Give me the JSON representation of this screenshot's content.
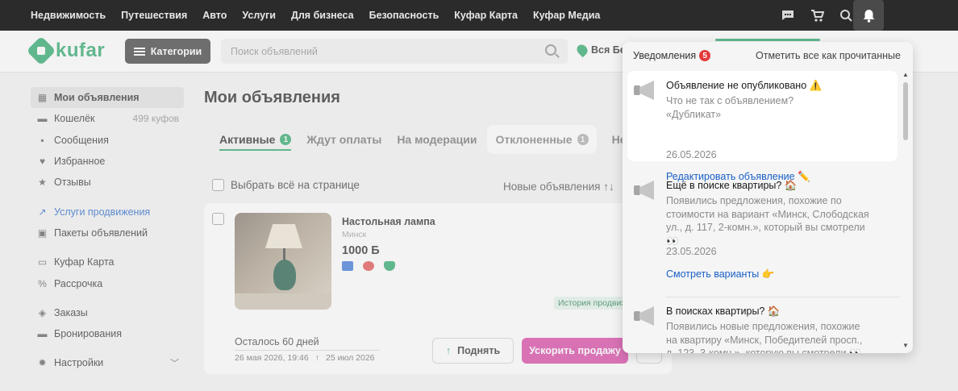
{
  "topnav": [
    "Недвижимость",
    "Путешествия",
    "Авто",
    "Услуги",
    "Для бизнеса",
    "Безопасность",
    "Куфар Карта",
    "Куфар Медиа"
  ],
  "top_icons": [
    "chat-icon",
    "cart-icon",
    "search-saved-icon",
    "heart-icon",
    "bell-icon"
  ],
  "header": {
    "logo": "kufar",
    "categories_label": "Категории",
    "search_placeholder": "Поиск объявлений",
    "region": "Вся Бе"
  },
  "sidebar": {
    "items": [
      {
        "label": "Мои объявления",
        "icon": "grid-icon",
        "active": true
      },
      {
        "label": "Кошелёк",
        "icon": "wallet-icon",
        "extra": "499 куфов"
      },
      {
        "label": "Сообщения",
        "icon": "chat-icon"
      },
      {
        "label": "Избранное",
        "icon": "heart-icon"
      },
      {
        "label": "Отзывы",
        "icon": "star-icon"
      },
      {
        "label": "Услуги продвижения",
        "icon": "trend-icon",
        "link": true
      },
      {
        "label": "Пакеты объявлений",
        "icon": "package-icon"
      },
      {
        "label": "Куфар Карта",
        "icon": "card-icon"
      },
      {
        "label": "Рассрочка",
        "icon": "percent-icon"
      },
      {
        "label": "Заказы",
        "icon": "box-icon"
      },
      {
        "label": "Бронирования",
        "icon": "bed-icon"
      },
      {
        "label": "Настройки",
        "icon": "gear-icon"
      }
    ]
  },
  "main": {
    "title": "Мои объявления",
    "tabs": [
      {
        "label": "Активные",
        "count": "1"
      },
      {
        "label": "Ждут оплаты"
      },
      {
        "label": "На модерации"
      },
      {
        "label": "Отклоненные",
        "count": "1"
      },
      {
        "label": "Неакти"
      }
    ],
    "select_all": "Выбрать всё на странице",
    "sort": "Новые объявления ↑↓",
    "ad": {
      "title": "Настольная лампа",
      "city": "Минск",
      "price": "1000 Б",
      "history": "История продвиж",
      "remaining": "Осталось 60 дней",
      "date_from": "26 мая 2026, 19:46",
      "date_to": "25 июл 2026",
      "raise_label": "Поднять",
      "boost_label": "Ускорить продажу"
    }
  },
  "notifications": {
    "title": "Уведомления",
    "count": "5",
    "mark_all": "Отметить все как прочитанные",
    "items": [
      {
        "title": "Объявление не опубликовано ⚠️",
        "body": "Что не так с объявлением? «Дубликат»",
        "date": "26.05.2026",
        "link": "Редактировать объявление ✏️"
      },
      {
        "title": "Ещё в поиске квартиры? 🏠",
        "body": "Появились предложения, похожие по стоимости на вариант «Минск, Слободская ул., д. 117, 2-комн.», который вы смотрели 👀",
        "date": "23.05.2026",
        "link": "Смотреть варианты 👉"
      },
      {
        "title": "В поисках квартиры? 🏠",
        "body": "Появились новые предложения, похожие на квартиру «Минск, Победителей просп., д. 123, 3-комн.», которую вы смотрели 👀"
      }
    ]
  },
  "colors": {
    "brand": "#1fa363",
    "boost": "#d63aa0",
    "link": "#1a5fc6",
    "badge_red": "#e23b3b"
  }
}
